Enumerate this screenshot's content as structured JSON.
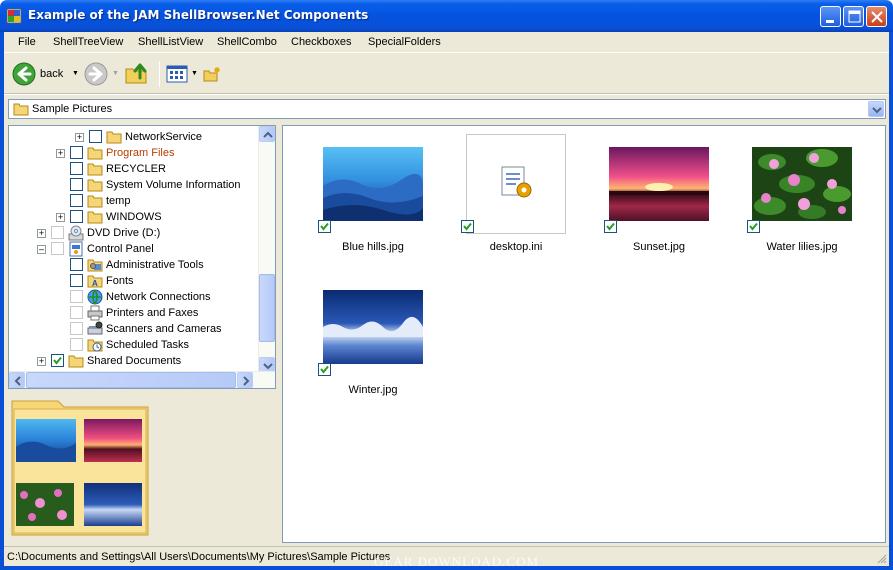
{
  "window": {
    "title": "Example of the JAM ShellBrowser.Net Components",
    "minimize_icon": "minimize-icon",
    "maximize_icon": "maximize-icon",
    "close_icon": "close-icon"
  },
  "menu": [
    "File",
    "ShellTreeView",
    "ShellListView",
    "ShellCombo",
    "Checkboxes",
    "SpecialFolders"
  ],
  "toolbar": {
    "back_label": "back",
    "back_icon": "back-arrow-icon",
    "forward_icon": "forward-arrow-icon",
    "up_icon": "folder-up-icon",
    "views_icon": "view-mode-icon",
    "new_folder_icon": "new-folder-icon"
  },
  "combo": {
    "value": "Sample Pictures"
  },
  "tree": {
    "items": [
      {
        "label": "NetworkService",
        "indent": 3,
        "expander": "+",
        "checkbox": true,
        "checked": false,
        "icon": "folder-icon",
        "color": "#000000"
      },
      {
        "label": "Program Files",
        "indent": 2,
        "expander": "+",
        "checkbox": true,
        "checked": false,
        "icon": "folder-icon",
        "color": "#b54000"
      },
      {
        "label": "RECYCLER",
        "indent": 2,
        "expander": "",
        "checkbox": true,
        "checked": false,
        "icon": "folder-icon",
        "color": "#000000"
      },
      {
        "label": "System Volume Information",
        "indent": 2,
        "expander": "",
        "checkbox": true,
        "checked": false,
        "icon": "folder-icon",
        "color": "#000000"
      },
      {
        "label": "temp",
        "indent": 2,
        "expander": "",
        "checkbox": true,
        "checked": false,
        "icon": "folder-icon",
        "color": "#000000"
      },
      {
        "label": "WINDOWS",
        "indent": 2,
        "expander": "+",
        "checkbox": true,
        "checked": false,
        "icon": "folder-icon",
        "color": "#000000"
      },
      {
        "label": "DVD Drive (D:)",
        "indent": 1,
        "expander": "+",
        "checkbox": true,
        "checked": false,
        "faint": true,
        "icon": "dvd-drive-icon",
        "color": "#000000"
      },
      {
        "label": "Control Panel",
        "indent": 1,
        "expander": "-",
        "checkbox": true,
        "checked": false,
        "faint": true,
        "icon": "control-panel-icon",
        "color": "#000000"
      },
      {
        "label": "Administrative Tools",
        "indent": 2,
        "expander": "",
        "checkbox": true,
        "checked": false,
        "icon": "admin-tools-icon",
        "color": "#000000"
      },
      {
        "label": "Fonts",
        "indent": 2,
        "expander": "",
        "checkbox": true,
        "checked": false,
        "icon": "fonts-folder-icon",
        "color": "#000000"
      },
      {
        "label": "Network Connections",
        "indent": 2,
        "expander": "",
        "checkbox": true,
        "checked": false,
        "faint": true,
        "icon": "network-connections-icon",
        "color": "#000000"
      },
      {
        "label": "Printers and Faxes",
        "indent": 2,
        "expander": "",
        "checkbox": true,
        "checked": false,
        "faint": true,
        "icon": "printers-icon",
        "color": "#000000"
      },
      {
        "label": "Scanners and Cameras",
        "indent": 2,
        "expander": "",
        "checkbox": true,
        "checked": false,
        "faint": true,
        "icon": "scanner-icon",
        "color": "#000000"
      },
      {
        "label": "Scheduled Tasks",
        "indent": 2,
        "expander": "",
        "checkbox": true,
        "checked": false,
        "faint": true,
        "icon": "scheduled-tasks-icon",
        "color": "#000000"
      },
      {
        "label": "Shared Documents",
        "indent": 1,
        "expander": "+",
        "checkbox": true,
        "checked": true,
        "icon": "folder-icon",
        "color": "#000000"
      }
    ]
  },
  "files": [
    {
      "name": "Blue hills.jpg",
      "checked": true,
      "thumb": "blue-hills-thumbnail"
    },
    {
      "name": "desktop.ini",
      "checked": true,
      "thumb": "ini-file-icon"
    },
    {
      "name": "Sunset.jpg",
      "checked": true,
      "thumb": "sunset-thumbnail"
    },
    {
      "name": "Water lilies.jpg",
      "checked": true,
      "thumb": "water-lilies-thumbnail"
    },
    {
      "name": "Winter.jpg",
      "checked": true,
      "thumb": "winter-thumbnail"
    }
  ],
  "status": {
    "path": "C:\\Documents and Settings\\All Users\\Documents\\My Pictures\\Sample Pictures"
  },
  "watermark": "GEAR DOWNLOAD.COM"
}
